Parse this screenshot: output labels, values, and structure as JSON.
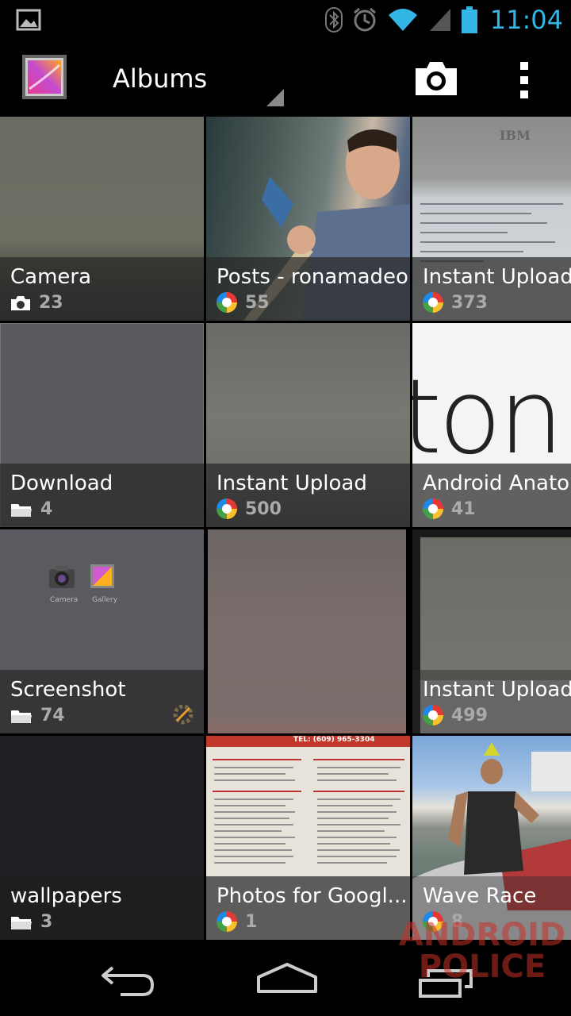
{
  "status_bar": {
    "time": "11:04",
    "icons": [
      "gallery-notification-icon",
      "bluetooth-icon",
      "alarm-icon",
      "wifi-icon",
      "signal-icon",
      "battery-icon"
    ]
  },
  "action_bar": {
    "title": "Albums",
    "actions": [
      "camera-icon",
      "overflow-menu-icon"
    ]
  },
  "albums": [
    {
      "title": "Camera",
      "count": "23",
      "type": "camera-icon"
    },
    {
      "title": "Posts - ronamadeo",
      "count": "55",
      "type": "picasa-icon"
    },
    {
      "title": "Instant Upload",
      "count": "373",
      "type": "picasa-icon"
    },
    {
      "title": "Download",
      "count": "4",
      "type": "folder-icon"
    },
    {
      "title": "Instant Upload",
      "count": "500",
      "type": "picasa-icon"
    },
    {
      "title": "Android Anator",
      "count": "41",
      "type": "picasa-icon"
    },
    {
      "title": "Screenshot",
      "count": "74",
      "type": "folder-icon"
    },
    {
      "title": "",
      "count": "",
      "type": ""
    },
    {
      "title": "Instant Upload",
      "count": "499",
      "type": "picasa-icon"
    },
    {
      "title": "wallpapers",
      "count": "3",
      "type": "folder-icon"
    },
    {
      "title": "Photos for Googl...",
      "count": "1",
      "type": "picasa-icon"
    },
    {
      "title": "Wave Race",
      "count": "8",
      "type": "picasa-icon"
    }
  ],
  "screenshot_thumb": {
    "label_a": "Camera",
    "label_b": "Gallery"
  },
  "thumb_text": {
    "ibm": "IBM",
    "menu_header": "TEL: (609) 965-3304",
    "anatomy_fragment": "ton"
  },
  "navigation": [
    "back-icon",
    "home-icon",
    "recent-apps-icon"
  ],
  "watermark": {
    "line1": "ANDROID",
    "line2": "POLICE"
  }
}
